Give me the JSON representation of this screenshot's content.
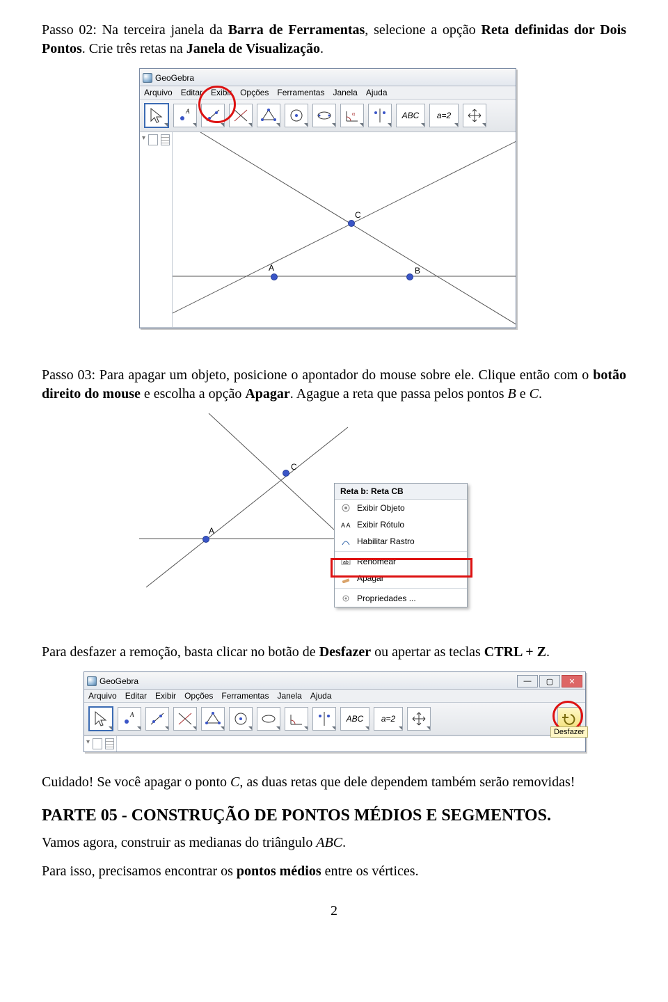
{
  "paragraphs": {
    "p1_a": "Passo 02: Na terceira janela da ",
    "p1_b": "Barra de Ferramentas",
    "p1_c": ", selecione a opção ",
    "p1_d": "Reta definidas dor Dois Pontos",
    "p1_e": ". Crie três retas na ",
    "p1_f": "Janela de Visualização",
    "p1_g": ".",
    "p2_a": "Passo 03: Para apagar um objeto, posicione o apontador do mouse sobre ele. Clique então com o ",
    "p2_b": "botão direito do mouse",
    "p2_c": " e escolha a opção ",
    "p2_d": "Apagar",
    "p2_e": ". Agague a reta que passa pelos pontos ",
    "p2_f": "B",
    "p2_g": " e ",
    "p2_h": "C",
    "p2_i": ".",
    "p3_a": "Para desfazer a remoção, basta clicar no botão de ",
    "p3_b": "Desfazer",
    "p3_c": " ou apertar as teclas ",
    "p3_d": "CTRL + Z",
    "p3_e": ".",
    "p4_a": "Cuidado! Se você apagar o ponto ",
    "p4_b": "C",
    "p4_c": ", as duas retas que dele dependem também serão removidas!",
    "h2": "PARTE 05 - CONSTRUÇÃO DE PONTOS MÉDIOS E SEGMENTOS.",
    "p5_a": "Vamos agora, construir as medianas do triângulo ",
    "p5_b": "ABC",
    "p5_c": ".",
    "p6_a": "Para isso, precisamos encontrar os ",
    "p6_b": "pontos médios",
    "p6_c": " entre os vértices."
  },
  "geogebra": {
    "title": "GeoGebra",
    "menu": [
      "Arquivo",
      "Editar",
      "Exibir",
      "Opções",
      "Ferramentas",
      "Janela",
      "Ajuda"
    ],
    "tool_abc": "ABC",
    "tool_eq": "a=2",
    "points": {
      "A": "A",
      "B": "B",
      "C": "C"
    }
  },
  "context_menu": {
    "title": "Reta b: Reta CB",
    "items": [
      "Exibir Objeto",
      "Exibir Rótulo",
      "Habilitar Rastro",
      "Renomear",
      "Apagar",
      "Propriedades ..."
    ]
  },
  "fig3": {
    "tooltip": "Desfazer"
  },
  "pagenum": "2"
}
